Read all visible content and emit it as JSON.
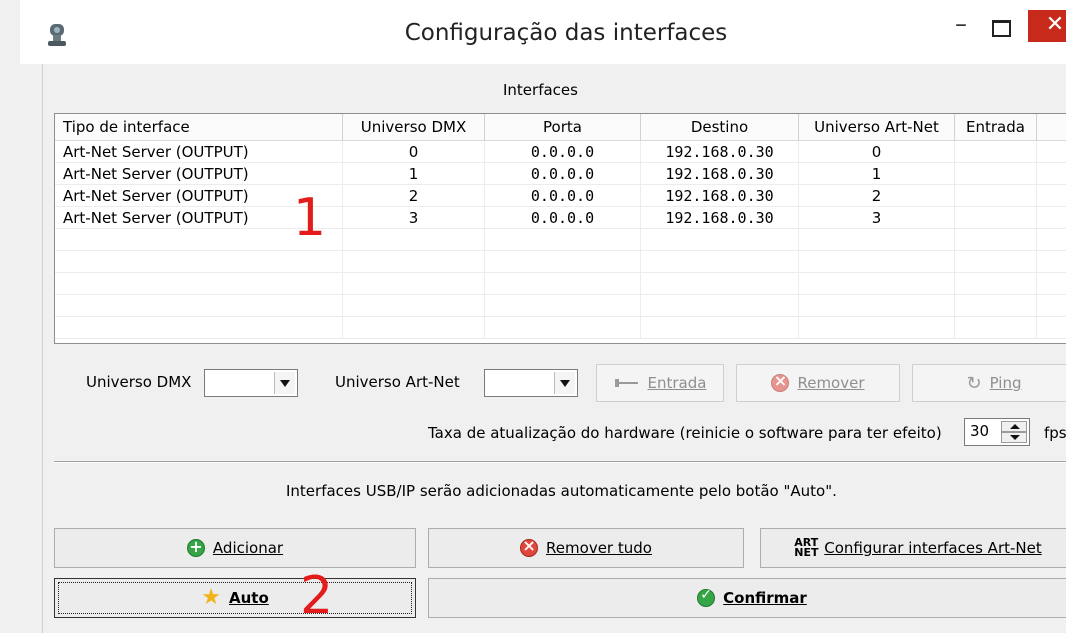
{
  "window": {
    "title": "Configuração das interfaces",
    "min_glyph": "–",
    "close_glyph": "✕"
  },
  "section": {
    "title": "Interfaces"
  },
  "table": {
    "columns": [
      "Tipo de interface",
      "Universo DMX",
      "Porta",
      "Destino",
      "Universo Art-Net",
      "Entrada"
    ],
    "rows": [
      [
        "Art-Net Server (OUTPUT)",
        "0",
        "0.0.0.0",
        "192.168.0.30",
        "0",
        ""
      ],
      [
        "Art-Net Server (OUTPUT)",
        "1",
        "0.0.0.0",
        "192.168.0.30",
        "1",
        ""
      ],
      [
        "Art-Net Server (OUTPUT)",
        "2",
        "0.0.0.0",
        "192.168.0.30",
        "2",
        ""
      ],
      [
        "Art-Net Server (OUTPUT)",
        "3",
        "0.0.0.0",
        "192.168.0.30",
        "3",
        ""
      ]
    ]
  },
  "annotations": {
    "marker1": "1",
    "marker2": "2"
  },
  "controls": {
    "universo_dmx_label": "Universo DMX",
    "universo_dmx_value": "",
    "universo_artnet_label": "Universo Art-Net",
    "universo_artnet_value": "",
    "entrada_button": "Entrada",
    "remover_button": "Remover",
    "ping_button": "Ping",
    "refresh_label": "Taxa de atualização do hardware (reinicie o software para ter efeito)",
    "refresh_value": "30",
    "refresh_unit": "fps"
  },
  "info_text": "Interfaces USB/IP serão adicionadas automaticamente pelo botão \"Auto\".",
  "buttons": {
    "adicionar": "Adicionar",
    "remover_tudo": "Remover tudo",
    "configurar_artnet": "Configurar interfaces Art-Net",
    "artnet_icon_top": "ART",
    "artnet_icon_bottom": "NET",
    "auto": "Auto",
    "confirmar": "Confirmar"
  },
  "colors": {
    "close_red": "#c7291b",
    "marker_red": "#e41b1b",
    "green_icon": "#35a546",
    "red_icon": "#e0473c"
  }
}
